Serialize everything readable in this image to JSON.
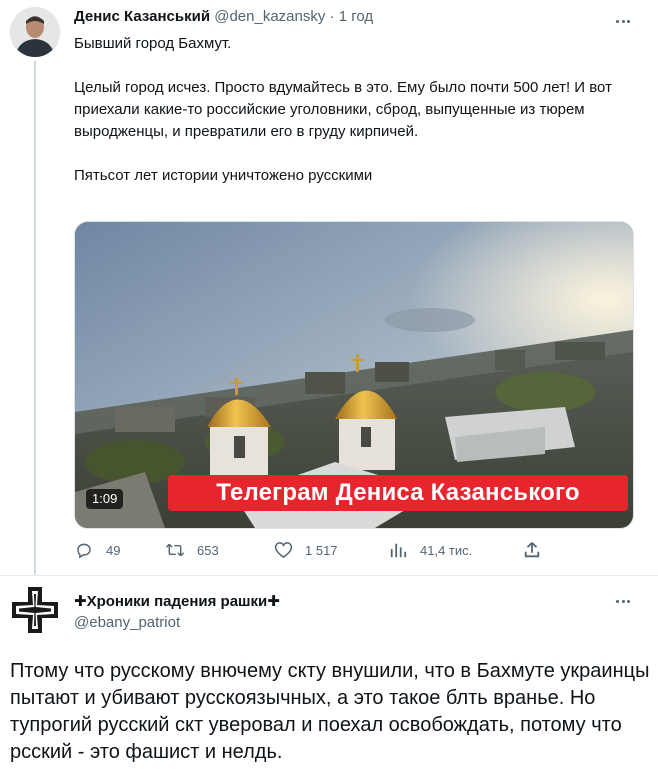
{
  "tweet1": {
    "author_name": "Денис Казанський",
    "handle": "@den_kazansky",
    "separator": "·",
    "time": "1 год",
    "paragraphs": [
      "Бывший город Бахмут.",
      "Целый город исчез. Просто вдумайтесь в это. Ему было почти 500 лет! И вот приехали какие-то российские уголовники, сброд, выпущенные из тюрем выродженцы, и превратили его в груду кирпичей.",
      "Пятьсот лет истории уничтожено русскими"
    ],
    "video": {
      "banner_text": "Телеграм Дениса Казанського",
      "duration": "1:09"
    },
    "actions": {
      "replies": "49",
      "retweets": "653",
      "likes": "1 517",
      "views": "41,4 тис."
    }
  },
  "tweet2": {
    "author_name": "✚Хроники падения рашки✚",
    "handle": "@ebany_patriot",
    "text": "Птому что русскому внючему скту внушили, что в Бахмуте украинцы пытают и убивают русскоязычных, а это такое блть вранье. Но тупрогий русский скт уверовал и поехал освобождать, потому что рсский - это фашист и нелдь."
  },
  "icons": {
    "reply": "reply-icon",
    "retweet": "retweet-icon",
    "like": "heart-icon",
    "views": "views-bar-chart-icon",
    "share": "share-icon",
    "more": "more-dots-icon"
  },
  "colors": {
    "text_primary": "#0f1419",
    "text_secondary": "#536471",
    "banner_red": "#e8242c"
  }
}
